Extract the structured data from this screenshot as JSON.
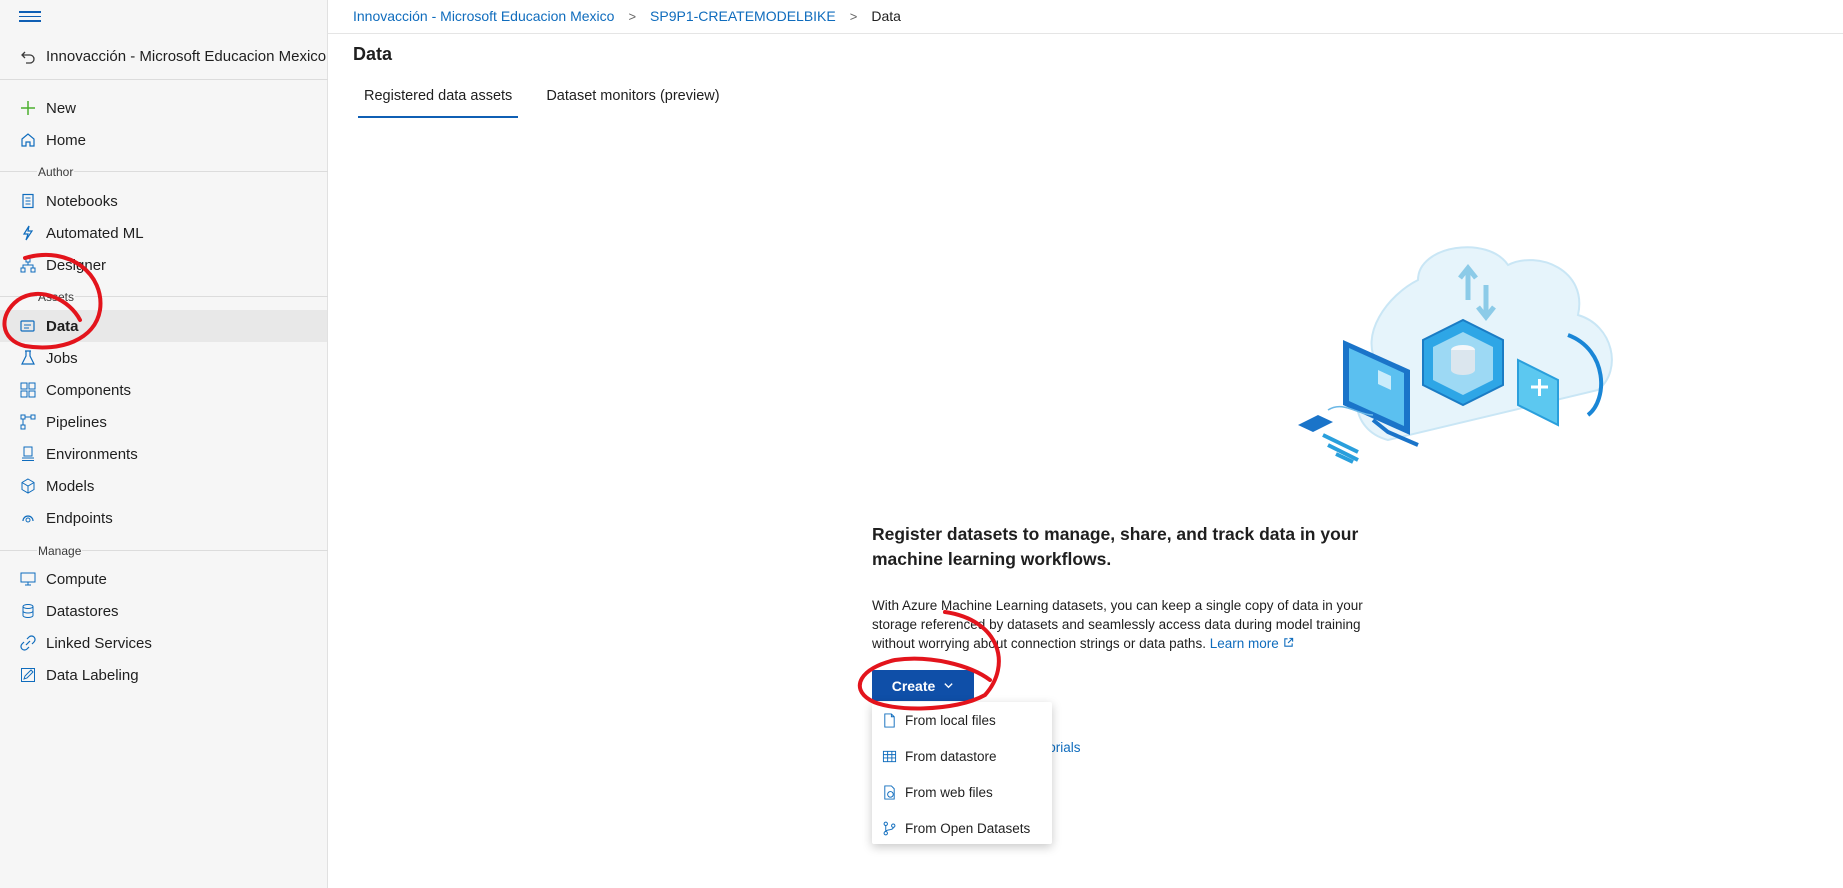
{
  "workspace": {
    "name": "Innovacción - Microsoft Educacion Mexico"
  },
  "sidebar": {
    "top_items": [
      {
        "label": "New",
        "icon": "plus-icon"
      },
      {
        "label": "Home",
        "icon": "home-icon"
      }
    ],
    "author_label": "Author",
    "author_items": [
      {
        "label": "Notebooks",
        "icon": "notebook-icon"
      },
      {
        "label": "Automated ML",
        "icon": "automl-icon"
      },
      {
        "label": "Designer",
        "icon": "designer-icon"
      }
    ],
    "assets_label": "Assets",
    "assets_items": [
      {
        "label": "Data",
        "icon": "data-icon",
        "active": true
      },
      {
        "label": "Jobs",
        "icon": "flask-icon"
      },
      {
        "label": "Components",
        "icon": "components-icon"
      },
      {
        "label": "Pipelines",
        "icon": "pipelines-icon"
      },
      {
        "label": "Environments",
        "icon": "environment-icon"
      },
      {
        "label": "Models",
        "icon": "cube-icon"
      },
      {
        "label": "Endpoints",
        "icon": "endpoint-icon"
      }
    ],
    "manage_label": "Manage",
    "manage_items": [
      {
        "label": "Compute",
        "icon": "monitor-icon"
      },
      {
        "label": "Datastores",
        "icon": "database-icon"
      },
      {
        "label": "Linked Services",
        "icon": "link-icon"
      },
      {
        "label": "Data Labeling",
        "icon": "labeling-icon"
      }
    ]
  },
  "breadcrumb": {
    "items": [
      "Innovacción - Microsoft Educacion Mexico",
      "SP9P1-CREATEMODELBIKE"
    ],
    "current": "Data"
  },
  "page": {
    "title": "Data",
    "tabs": [
      {
        "label": "Registered data assets",
        "active": true
      },
      {
        "label": "Dataset monitors (preview)",
        "active": false
      }
    ]
  },
  "empty_state": {
    "headline": "Register datasets to manage, share, and track data in your machine learning workflows.",
    "description": "With Azure Machine Learning datasets, you can keep a single copy of data in your storage referenced by datasets and seamlessly access data during model training without worrying about connection strings or data paths.",
    "learn_more": "Learn more",
    "create_label": "Create",
    "tutorials_link": "g tutorials"
  },
  "create_menu": [
    {
      "label": "From local files",
      "icon": "file-icon"
    },
    {
      "label": "From datastore",
      "icon": "table-icon"
    },
    {
      "label": "From web files",
      "icon": "web-file-icon"
    },
    {
      "label": "From Open Datasets",
      "icon": "branch-icon"
    }
  ],
  "colors": {
    "accent": "#0f4fa8",
    "link": "#0f6cbd",
    "annotation": "#e3141c"
  }
}
